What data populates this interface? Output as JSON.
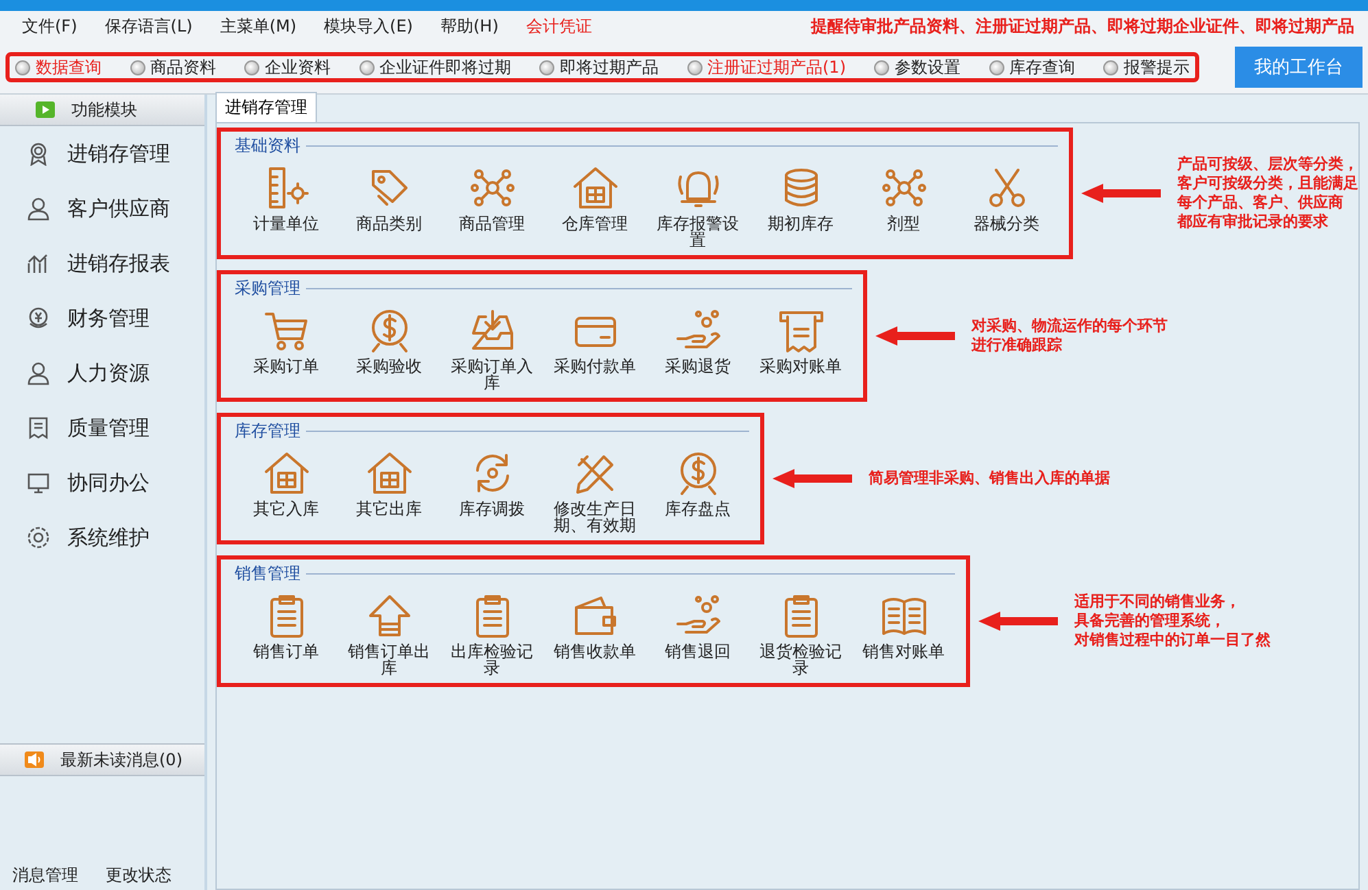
{
  "menu": [
    {
      "label": "文件(F)",
      "highlighted": false
    },
    {
      "label": "保存语言(L)",
      "highlighted": false
    },
    {
      "label": "主菜单(M)",
      "highlighted": false
    },
    {
      "label": "模块导入(E)",
      "highlighted": false
    },
    {
      "label": "帮助(H)",
      "highlighted": false
    },
    {
      "label": "会计凭证",
      "highlighted": true
    }
  ],
  "alert_banner": "提醒待审批产品资料、注册证过期产品、即将过期企业证件、即将过期产品",
  "quick_links": [
    {
      "label": "数据查询",
      "highlighted": true
    },
    {
      "label": "商品资料",
      "highlighted": false
    },
    {
      "label": "企业资料",
      "highlighted": false
    },
    {
      "label": "企业证件即将过期",
      "highlighted": false
    },
    {
      "label": "即将过期产品",
      "highlighted": false
    },
    {
      "label": "注册证过期产品(1)",
      "highlighted": true
    },
    {
      "label": "参数设置",
      "highlighted": false
    },
    {
      "label": "库存查询",
      "highlighted": false
    },
    {
      "label": "报警提示",
      "highlighted": false
    }
  ],
  "workbench_button": "我的工作台",
  "sidebar": {
    "title": "功能模块",
    "items": [
      "进销存管理",
      "客户供应商",
      "进销存报表",
      "财务管理",
      "人力资源",
      "质量管理",
      "协同办公",
      "系统维护"
    ]
  },
  "messages": {
    "title": "最新未读消息(0)",
    "links": [
      "消息管理",
      "更改状态"
    ]
  },
  "tab": {
    "label": "进销存管理",
    "selected": true
  },
  "sections": [
    {
      "title": "基础资料",
      "items": [
        "计量单位",
        "商品类别",
        "商品管理",
        "仓库管理",
        "库存报警设置",
        "期初库存",
        "剂型",
        "器械分类"
      ],
      "note": [
        "产品可按级、层次等分类，",
        "客户可按级分类，且能满足",
        "每个产品、客户、供应商",
        "都应有审批记录的要求"
      ]
    },
    {
      "title": "采购管理",
      "items": [
        "采购订单",
        "采购验收",
        "采购订单入库",
        "采购付款单",
        "采购退货",
        "采购对账单"
      ],
      "note": [
        "对采购、物流运作的每个环节",
        "进行准确跟踪"
      ]
    },
    {
      "title": "库存管理",
      "items": [
        "其它入库",
        "其它出库",
        "库存调拨",
        "修改生产日期、有效期",
        "库存盘点"
      ],
      "note": [
        "简易管理非采购、销售出入库的单据"
      ]
    },
    {
      "title": "销售管理",
      "items": [
        "销售订单",
        "销售订单出库",
        "出库检验记录",
        "销售收款单",
        "销售退回",
        "退货检验记录",
        "销售对账单"
      ],
      "note": [
        "适用于不同的销售业务，",
        "具备完善的管理系统，",
        "对销售过程中的订单一目了然"
      ]
    }
  ]
}
